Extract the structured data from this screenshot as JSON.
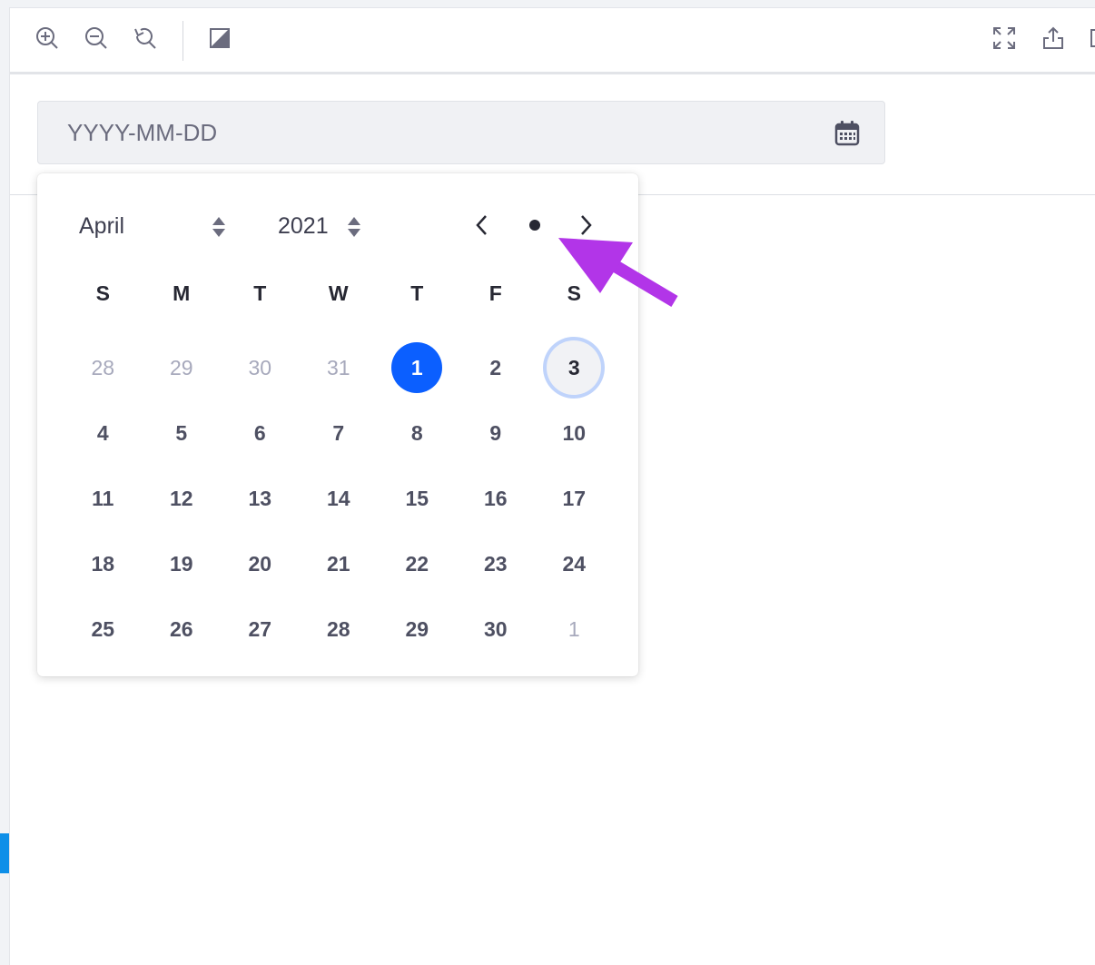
{
  "toolbar": {
    "zoom_in_icon": "zoom-in-icon",
    "zoom_out_icon": "zoom-out-icon",
    "reset_icon": "reset-zoom-icon",
    "contrast_icon": "contrast-icon",
    "fullscreen_icon": "fullscreen-icon",
    "share_icon": "share-icon"
  },
  "date_input": {
    "placeholder": "YYYY-MM-DD",
    "value": "",
    "icon": "calendar-icon"
  },
  "picker": {
    "month": "April",
    "year": "2021",
    "nav": {
      "prev": "chevron-left-icon",
      "today": "dot-icon",
      "next": "chevron-right-icon"
    },
    "weekdays": [
      "S",
      "M",
      "T",
      "W",
      "T",
      "F",
      "S"
    ],
    "weeks": [
      [
        "28",
        "29",
        "30",
        "31",
        "1",
        "2",
        "3"
      ],
      [
        "4",
        "5",
        "6",
        "7",
        "8",
        "9",
        "10"
      ],
      [
        "11",
        "12",
        "13",
        "14",
        "15",
        "16",
        "17"
      ],
      [
        "18",
        "19",
        "20",
        "21",
        "22",
        "23",
        "24"
      ],
      [
        "25",
        "26",
        "27",
        "28",
        "29",
        "30",
        "1"
      ]
    ],
    "selected_day": "1",
    "today_day": "3"
  },
  "colors": {
    "accent": "#0b5fff",
    "annotation_arrow": "#b235e8",
    "muted_day": "#a7a9bc",
    "day_text": "#4e5062"
  }
}
